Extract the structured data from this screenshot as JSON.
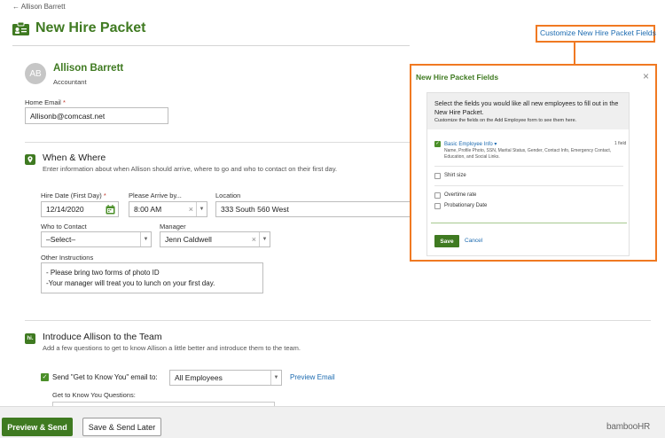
{
  "header": {
    "back_link": "← Allison Barrett",
    "title": "New Hire Packet",
    "customize_link": "Customize New Hire Packet Fields"
  },
  "employee": {
    "initials": "AB",
    "name": "Allison Barrett",
    "role": "Accountant"
  },
  "home_email": {
    "label": "Home Email",
    "required_mark": "*",
    "value": "Allisonb@comcast.net"
  },
  "when_where": {
    "title": "When & Where",
    "description": "Enter information about when Allison should arrive, where to go and who to contact on their first day.",
    "hire_date": {
      "label": "Hire Date (First Day)",
      "required_mark": "*",
      "value": "12/14/2020"
    },
    "arrive": {
      "label": "Please Arrive by...",
      "value": "8:00 AM"
    },
    "location": {
      "label": "Location",
      "value": "333 South 560 West"
    },
    "contact": {
      "label": "Who to Contact",
      "value": "–Select–"
    },
    "manager": {
      "label": "Manager",
      "value": "Jenn Caldwell"
    },
    "instructions": {
      "label": "Other Instructions",
      "lines": [
        "- Please bring two forms of photo ID",
        "-Your manager will treat you to lunch on your first day."
      ]
    }
  },
  "introduce": {
    "title": "Introduce Allison to the Team",
    "description": "Add a few questions to get to know Allison a little better and introduce them to the team.",
    "icon_text": "hi.",
    "send_email_label": "Send \"Get to Know You\" email to:",
    "send_email_checked": true,
    "recipients": "All Employees",
    "preview_email": "Preview Email",
    "questions_label": "Get to Know You Questions:"
  },
  "footer": {
    "preview_send": "Preview & Send",
    "save_later": "Save & Send Later",
    "logo_text": "bambooHR"
  },
  "modal": {
    "title": "New Hire Packet Fields",
    "intro_main": "Select the fields you would like all new employees to fill out in the New Hire Packet.",
    "intro_sub": "Customize the fields on the Add Employee form to see them here.",
    "basic_info": {
      "label": "Basic Employee Info ▾",
      "checked": true,
      "count": "1 field",
      "details": "Name, Profile Photo, SSN, Marital Status, Gender, Contact Info, Emergency Contact, Education, and Social Links."
    },
    "fields": [
      {
        "label": "Shirt size",
        "checked": false
      },
      {
        "label": "Overtime rate",
        "checked": false
      },
      {
        "label": "Probationary Date",
        "checked": false
      }
    ],
    "save": "Save",
    "cancel": "Cancel"
  },
  "colors": {
    "brand_green": "#3f7a21",
    "link_blue": "#1b6ab0",
    "highlight_orange": "#f07922"
  },
  "icons": {
    "title": "id-card-icon",
    "when_where": "map-pin-icon",
    "introduce": "chat-bubble-icon",
    "date": "calendar-icon"
  }
}
